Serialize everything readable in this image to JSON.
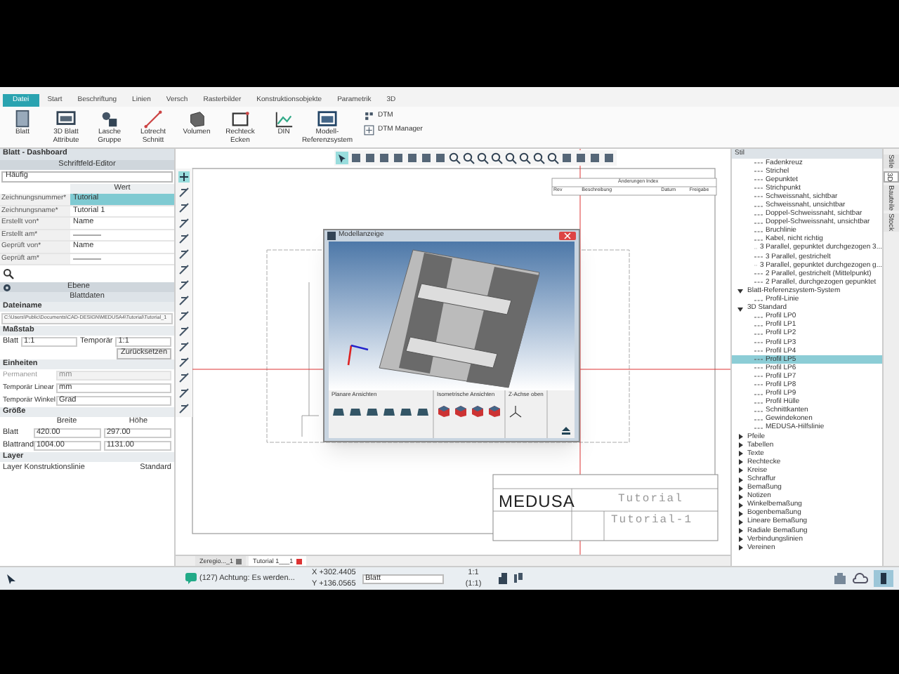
{
  "ribbon_tabs": [
    {
      "label": "Datei",
      "selected": true
    },
    {
      "label": "Start",
      "selected": false
    },
    {
      "label": "Beschriftung",
      "selected": false
    },
    {
      "label": "Linien",
      "selected": false
    },
    {
      "label": "Versch",
      "selected": false
    },
    {
      "label": "Rasterbilder",
      "selected": false
    },
    {
      "label": "Konstruktionsobjekte",
      "selected": false
    },
    {
      "label": "Parametrik",
      "selected": false
    },
    {
      "label": "3D",
      "selected": false
    }
  ],
  "ribbon_buttons": [
    {
      "label": "Blatt"
    },
    {
      "label": "3D Blatt Attribute"
    },
    {
      "label": "Lasche Gruppe"
    },
    {
      "label": "Lotrecht Schnitt"
    },
    {
      "label": "Volumen"
    },
    {
      "label": "Rechteck Ecken"
    },
    {
      "label": "DIN"
    },
    {
      "label": "Modell-Referenzsystem"
    },
    {
      "label": "DTM"
    },
    {
      "label": "DTM Manager"
    }
  ],
  "left_panel": {
    "title": "Blatt - Dashboard",
    "editor": {
      "title": "Schriftfeld-Editor",
      "filter": "Häufig",
      "column": "Wert",
      "rows": [
        {
          "label": "Zeichnungsnummer*",
          "value": "Tutorial",
          "selected": true
        },
        {
          "label": "Zeichnungsname*",
          "value": "Tutorial 1",
          "selected": false
        },
        {
          "label": "Erstellt von*",
          "value": "Name",
          "selected": false
        },
        {
          "label": "Erstellt am*",
          "selected": false
        },
        {
          "label": "Geprüft von*",
          "value": "Name",
          "selected": false
        },
        {
          "label": "Geprüft am*",
          "selected": false
        }
      ]
    },
    "section": "Ebene",
    "data_title": "Blattdaten",
    "file": {
      "label": "Dateiname",
      "value": "C:\\Users\\Public\\Documents\\CAD-DESIGN\\MEDUSA4\\Tutorial\\Tutorial_1"
    },
    "scale": {
      "label": "Maßstab",
      "sheet_label": "Blatt",
      "sheet_value": "1:1",
      "temp_label": "Temporär",
      "temp_value": "1:1",
      "button": "Zurücksetzen"
    },
    "units": {
      "label": "Einheiten",
      "rows": [
        {
          "label": "Permanent",
          "value": "mm",
          "disabled": true
        },
        {
          "label": "Temporär Linear",
          "value": "mm",
          "disabled": false
        },
        {
          "label": "Temporär Winkel",
          "value": "Grad",
          "disabled": false
        }
      ]
    },
    "size": {
      "label": "Größe",
      "columns": [
        "Breite",
        "Höhe"
      ],
      "rows": [
        {
          "label": "Blatt",
          "values": [
            "420.00",
            "297.00"
          ]
        },
        {
          "label": "Blattrand",
          "values": [
            "1004.00",
            "1131.00"
          ]
        }
      ]
    },
    "layer": {
      "label": "Layer",
      "name": "Layer Konstruktionslinie",
      "value": "Standard"
    }
  },
  "canvas": {
    "revision_title": "Änderungen Index",
    "revision_columns": [
      "Rev",
      "Beschreibung",
      "Datum",
      "Freigabe"
    ],
    "logo": "MEDUSA",
    "title": "Tutorial",
    "drawing_number": "Tutorial-1",
    "dialog": {
      "title": "Modellanzeige",
      "groups": [
        "Planare Ansichten",
        "Isometrische Ansichten",
        "Z-Achse oben"
      ]
    }
  },
  "doc_tabs": [
    {
      "label": "Zeregio..._1",
      "selected": false
    },
    {
      "label": "Tutorial 1___1",
      "selected": true
    }
  ],
  "right_panel": {
    "title": "Stil",
    "continued_items": [
      {
        "label": "Fadenkreuz",
        "selected": false
      },
      {
        "label": "Strichel",
        "selected": false
      },
      {
        "label": "Gepunktet",
        "selected": false
      },
      {
        "label": "Strichpunkt",
        "selected": false
      },
      {
        "label": "Schweissnaht, sichtbar",
        "selected": false
      },
      {
        "label": "Schweissnaht, unsichtbar",
        "selected": false
      },
      {
        "label": "Doppel-Schweissnaht, sichtbar",
        "selected": false
      },
      {
        "label": "Doppel-Schweissnaht, unsichtbar",
        "selected": false
      },
      {
        "label": "Bruchlinie",
        "selected": false
      },
      {
        "label": "Kabel, nicht richtig",
        "selected": false
      },
      {
        "label": "3 Parallel, gepunktet durchgezogen 3...",
        "selected": false
      },
      {
        "label": "3 Parallel, gestrichelt",
        "selected": false
      },
      {
        "label": "3 Parallel, gepunktet durchgezogen g...",
        "selected": false
      },
      {
        "label": "2 Parallel, gestrichelt (Mittelpunkt)",
        "selected": false
      },
      {
        "label": "2 Parallel, durchgezogen gepunktet",
        "selected": false
      }
    ],
    "nodes": [
      {
        "label": "Blatt-Referenzsystem-System",
        "expanded": true,
        "children": [
          {
            "label": "Profil-Linie",
            "selected": false
          }
        ]
      },
      {
        "label": "3D Standard",
        "expanded": true,
        "children": [
          {
            "label": "Profil LP0",
            "selected": false
          },
          {
            "label": "Profil LP1",
            "selected": false
          },
          {
            "label": "Profil LP2",
            "selected": false
          },
          {
            "label": "Profil LP3",
            "selected": false
          },
          {
            "label": "Profil LP4",
            "selected": false
          },
          {
            "label": "Profil LP5",
            "selected": true
          },
          {
            "label": "Profil LP6",
            "selected": false
          },
          {
            "label": "Profil LP7",
            "selected": false
          },
          {
            "label": "Profil LP8",
            "selected": false
          },
          {
            "label": "Profil LP9",
            "selected": false
          },
          {
            "label": "Profil Hülle",
            "selected": false
          },
          {
            "label": "Schnittkanten",
            "selected": false
          },
          {
            "label": "Gewindekonen",
            "selected": false
          },
          {
            "label": "MEDUSA-Hilfslinie",
            "selected": false
          }
        ]
      },
      {
        "label": "Pfeile",
        "expanded": false
      },
      {
        "label": "Tabellen",
        "expanded": false
      },
      {
        "label": "Texte",
        "expanded": false
      },
      {
        "label": "Rechtecke",
        "expanded": false
      },
      {
        "label": "Kreise",
        "expanded": false
      },
      {
        "label": "Schraffur",
        "expanded": false
      },
      {
        "label": "Bemaßung",
        "expanded": false
      },
      {
        "label": "Notizen",
        "expanded": false
      },
      {
        "label": "Winkelbemaßung",
        "expanded": false
      },
      {
        "label": "Bogenbemaßung",
        "expanded": false
      },
      {
        "label": "Lineare Bemaßung",
        "expanded": false
      },
      {
        "label": "Radiale Bemaßung",
        "expanded": false
      },
      {
        "label": "Verbindungslinien",
        "expanded": false
      },
      {
        "label": "Vereinen",
        "expanded": false
      }
    ]
  },
  "side_tabs": [
    {
      "label": "Stile",
      "selected": false
    },
    {
      "label": "3D",
      "selected": true
    },
    {
      "label": "Bauteile",
      "selected": false
    },
    {
      "label": "Stock",
      "selected": false
    }
  ],
  "status_bar": {
    "message": "(127) Achtung: Es werden...",
    "x": "X +302.4405",
    "y": "Y +136.0565",
    "field": "Blatt",
    "scale": "1:1",
    "scale_temp": "(1:1)"
  }
}
